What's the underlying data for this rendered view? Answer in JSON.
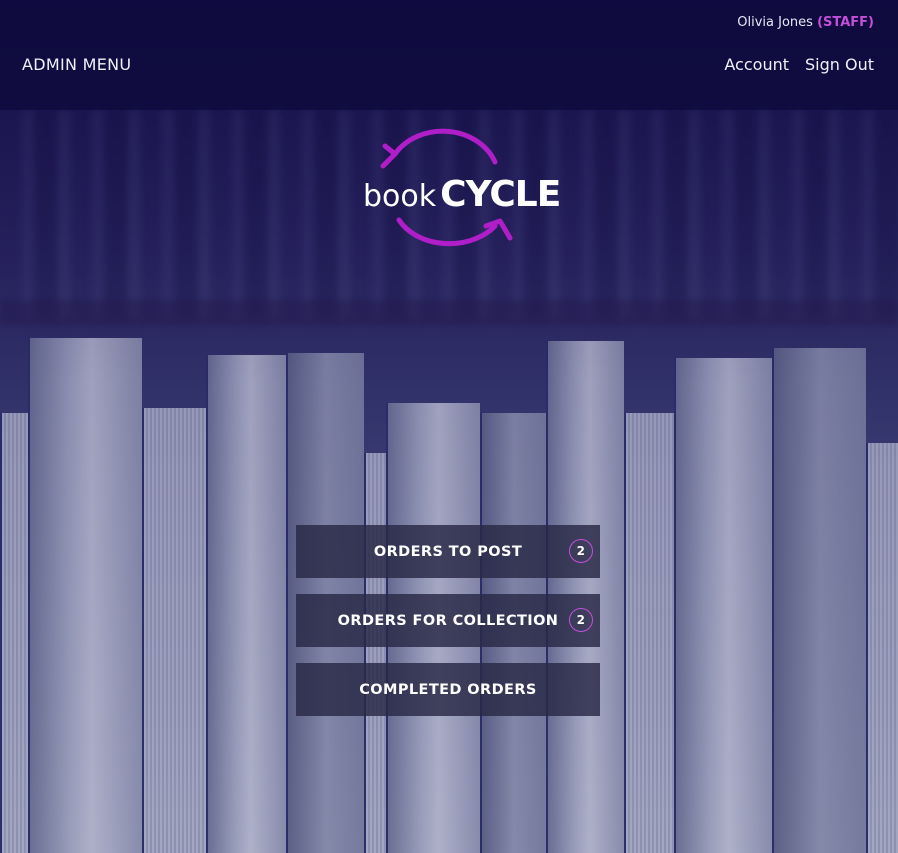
{
  "header": {
    "user_name": "Olivia Jones",
    "user_role": "(STAFF)",
    "admin_menu_label": "ADMIN MENU",
    "account_label": "Account",
    "signout_label": "Sign Out"
  },
  "logo": {
    "word1": "book",
    "word2": "CYCLE"
  },
  "menu": {
    "items": [
      {
        "label": "ORDERS TO POST",
        "badge": "2"
      },
      {
        "label": "ORDERS FOR COLLECTION",
        "badge": "2"
      },
      {
        "label": "COMPLETED ORDERS"
      }
    ]
  },
  "colors": {
    "accent": "#c24fd8",
    "header_bg": "#0c0a3c",
    "button_bg": "#28284a"
  }
}
